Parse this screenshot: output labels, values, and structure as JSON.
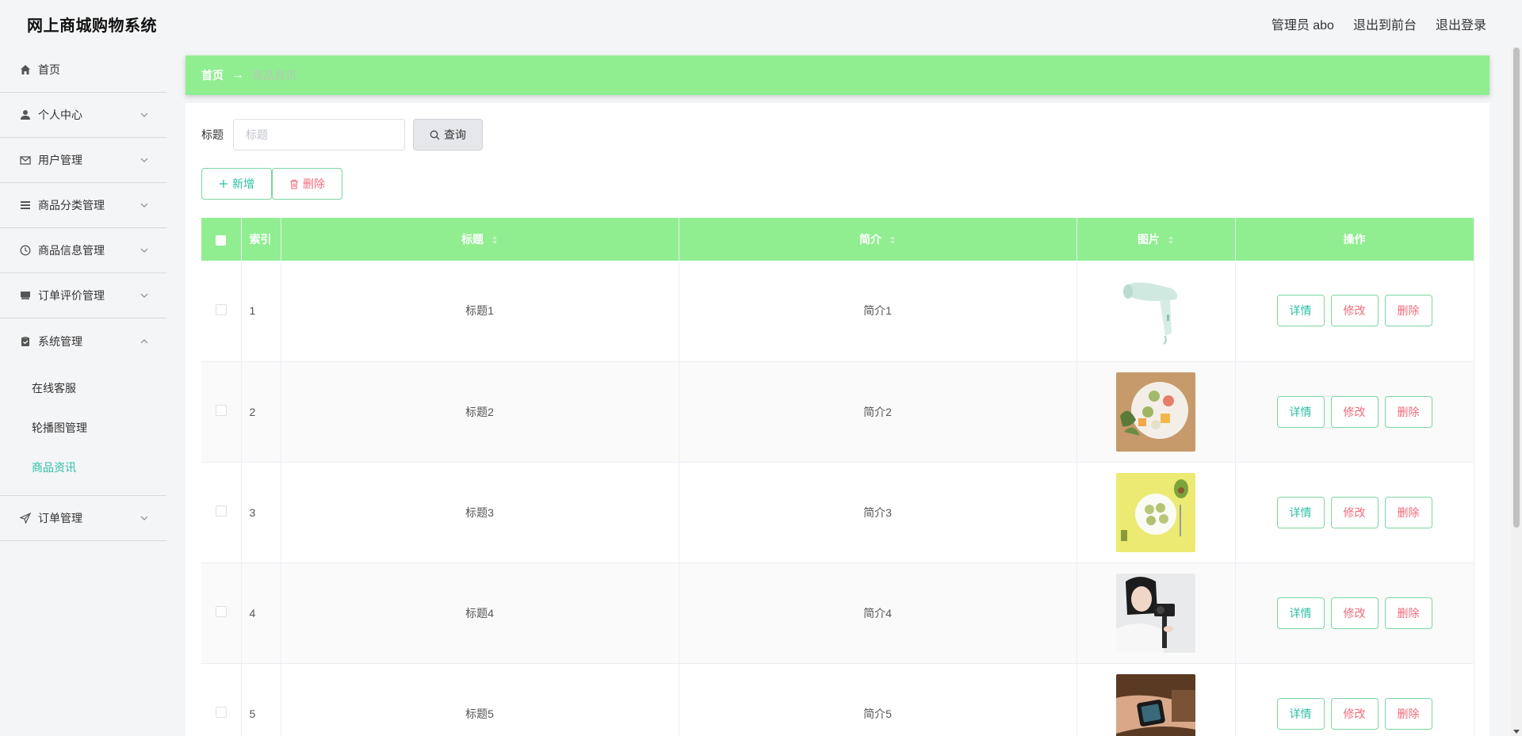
{
  "header": {
    "app_title": "网上商城购物系统",
    "admin_label": "管理员 abo",
    "to_front": "退出到前台",
    "logout": "退出登录"
  },
  "sidebar": {
    "items": [
      {
        "label": "首页",
        "icon": "home-icon"
      },
      {
        "label": "个人中心",
        "icon": "user-icon"
      },
      {
        "label": "用户管理",
        "icon": "mail-icon"
      },
      {
        "label": "商品分类管理",
        "icon": "list-icon"
      },
      {
        "label": "商品信息管理",
        "icon": "clock-icon"
      },
      {
        "label": "订单评价管理",
        "icon": "box-icon"
      },
      {
        "label": "系统管理",
        "icon": "clipboard-icon"
      },
      {
        "label": "订单管理",
        "icon": "send-icon"
      }
    ],
    "submenu": [
      {
        "label": "在线客服"
      },
      {
        "label": "轮播图管理"
      },
      {
        "label": "商品资讯",
        "active": true
      }
    ]
  },
  "breadcrumb": {
    "home": "首页",
    "separator": "→",
    "current": "商品资讯"
  },
  "search": {
    "label": "标题",
    "placeholder": "标题",
    "value": "",
    "button": "查询"
  },
  "actions": {
    "add": "新增",
    "delete": "删除"
  },
  "table": {
    "columns": [
      "索引",
      "标题",
      "简介",
      "图片",
      "操作"
    ],
    "rows": [
      {
        "index": "1",
        "title": "标题1",
        "intro": "简介1",
        "image": "hair-dryer"
      },
      {
        "index": "2",
        "title": "标题2",
        "intro": "简介2",
        "image": "mooncakes-plate"
      },
      {
        "index": "3",
        "title": "标题3",
        "intro": "简介3",
        "image": "green-cakes"
      },
      {
        "index": "4",
        "title": "标题4",
        "intro": "简介4",
        "image": "camera-girl"
      },
      {
        "index": "5",
        "title": "标题5",
        "intro": "简介5",
        "image": "smartwatch"
      }
    ],
    "row_actions": {
      "detail": "详情",
      "edit": "修改",
      "delete": "删除"
    }
  },
  "colors": {
    "accent_green": "#90ee90",
    "teal_text": "#2bbfa4",
    "red_text": "#f06a7a"
  }
}
